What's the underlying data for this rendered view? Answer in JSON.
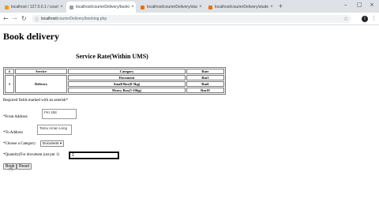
{
  "browser": {
    "tabs": [
      {
        "label": "localhost / 127.0.0.1 / courier_ser",
        "fav_color": "#f29900",
        "active": false
      },
      {
        "label": "localhost/courierDelivery/booking",
        "fav_color": "#9aa0a6",
        "active": true
      },
      {
        "label": "localhost/courierDelivery/stude",
        "fav_color": "#e8710a",
        "active": false
      },
      {
        "label": "localhost/courierDelivery/stude",
        "fav_color": "#e8710a",
        "active": false
      }
    ],
    "tab_close_glyph": "×",
    "new_tab_glyph": "+",
    "window_controls": [
      "–",
      "□",
      "×"
    ],
    "url_host": "localhost",
    "url_path": "/courierDelivery/booking.php",
    "avatar_letter": "I"
  },
  "page": {
    "title": "Book delivery",
    "rate_title": "Service Rate(Within UMS)",
    "table": {
      "headers": [
        "#",
        "Service",
        "Category",
        "Rate"
      ],
      "row_num": "1",
      "service": "Delivery",
      "rows": [
        {
          "category": "Document",
          "rate": "Rm3"
        },
        {
          "category": "Small Box(0-5kg)",
          "rate": "Rm6"
        },
        {
          "category": "Heavy Box(5-10kg)",
          "rate": "Rm10"
        }
      ]
    },
    "required_note": "Required fields marked with an asterisk*",
    "form": {
      "from_label": "*From Address",
      "from_value": "FKI 408",
      "to_label": "*To Address",
      "to_value": "Tamu Aman Leng",
      "category_label": "*Choose a Category:",
      "category_selected": "Document",
      "quantity_label": "*Quantity(For document just put 1)",
      "quantity_value": "1",
      "book_button": "Book",
      "reset_button": "Reset"
    }
  }
}
